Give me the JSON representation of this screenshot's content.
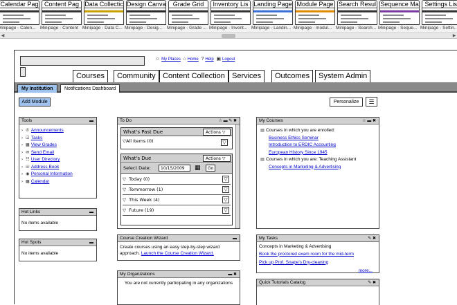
{
  "thumbnails": [
    {
      "title": "Calendar Pag",
      "caption": "Minipage - Calen...",
      "accent": "#333333"
    },
    {
      "title": "Content Pag",
      "caption": "Minipage - Content",
      "accent": "#333333"
    },
    {
      "title": "Data Collectic",
      "caption": "Minipage - Data C...",
      "accent": "#c8a000"
    },
    {
      "title": "Design Canva",
      "caption": "Minipage - Desig...",
      "accent": "#2a2a2a"
    },
    {
      "title": "Grade Grid",
      "caption": "Minipage - Grade ...",
      "accent": "#333333"
    },
    {
      "title": "Inventory Lis",
      "caption": "Minipage - Invent...",
      "accent": "#333333"
    },
    {
      "title": "Landing Page",
      "caption": "Minipage - Landin...",
      "accent": "#3a6fd8"
    },
    {
      "title": "Module Page",
      "caption": "Minipage - modul...",
      "accent": "#e08a00"
    },
    {
      "title": "Search Resul",
      "caption": "Minipage - Search...",
      "accent": "#333333"
    },
    {
      "title": "Sequence Ma",
      "caption": "Minipage - Seque...",
      "accent": "#7a3aa0"
    },
    {
      "title": "Settings List",
      "caption": "Minipage - Settin...",
      "accent": "#333333"
    }
  ],
  "toplinks": {
    "places": "My Places",
    "home": "Home",
    "help": "Help",
    "logout": "Logout"
  },
  "tabs": [
    "Courses",
    "Community",
    "Content Collection",
    "Services",
    "Outcomes",
    "System Admin"
  ],
  "subtabs": {
    "active": "My Institution",
    "inactive": "Notifications Dashboard"
  },
  "buttons": {
    "add_module": "Add Module",
    "personalize": "Personalize"
  },
  "tools": {
    "title": "Tools",
    "items": [
      "Announcements",
      "Tasks",
      "View Grades",
      "Send Email",
      "User Directory",
      "Address Book",
      "Personal Information",
      "Calendar"
    ]
  },
  "hot_links": {
    "title": "Hot Links",
    "text": "No items available"
  },
  "hot_spots": {
    "title": "Hot Spots",
    "text": "No items available"
  },
  "todo": {
    "title": "To Do",
    "past_due": {
      "title": "What's Past Due",
      "actions": "Actions",
      "all_items": "All Items (0)"
    },
    "due": {
      "title": "What's Due",
      "actions": "Actions",
      "select_date_label": "Select Date:",
      "date_value": "10/15/2009",
      "go": "Go"
    },
    "items": [
      "Today (0)",
      "Tommorrow (1)",
      "This Week (4)",
      "Future (19)"
    ]
  },
  "wizard": {
    "title": "Course Creation Wizard",
    "text": "Create courses using an easy step-by-step wizard approach.",
    "link": "Launch the Course Creation Wizard."
  },
  "orgs": {
    "title": "My Organizations",
    "text": "You are not currently participating in any organizations"
  },
  "courses": {
    "title": "My Courses",
    "enrolled_label": "Courses in which you are enrolled:",
    "enrolled": [
      "Business Ethics Seminar",
      "Introduction to ERDIC Accounting",
      "European History Since 1945"
    ],
    "ta_label": "Courses in which you are: Teaching Assistant",
    "ta": [
      "Concepts in Marketing & Advertising"
    ]
  },
  "tasks": {
    "title": "My Tasks",
    "course": "Concepts in Marketing & Advertising",
    "items": [
      "Book the proctored exam room for the mid-term",
      "Pick up Prof. Snape's Dry-cleaning"
    ],
    "more": "more..."
  },
  "quick": {
    "title": "Quick Tutorials Catalog"
  }
}
